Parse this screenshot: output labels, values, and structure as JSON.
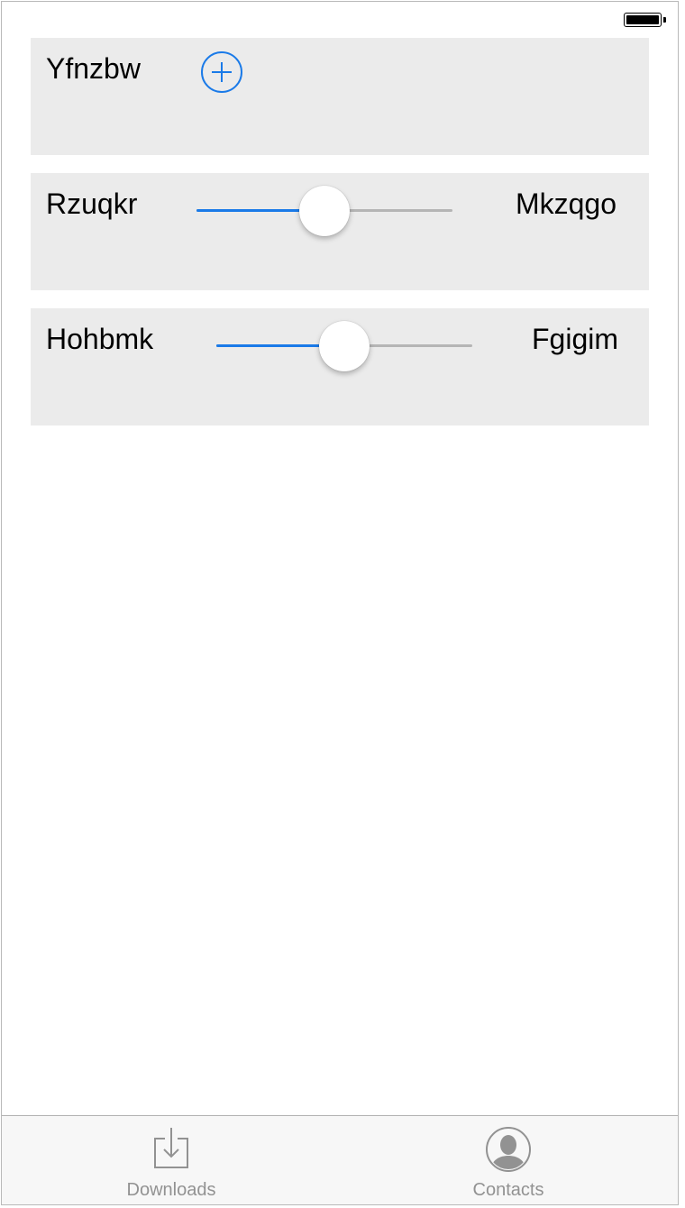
{
  "status_bar": {
    "battery_level": 1.0
  },
  "rows": [
    {
      "label": "Yfnzbw",
      "control": "add-button",
      "control_icon": "plus-circle-icon"
    },
    {
      "label": "Rzuqkr",
      "control": "slider",
      "value": 0.5,
      "trailing_label": "Mkzqgo"
    },
    {
      "label": "Hohbmk",
      "control": "slider",
      "value": 0.5,
      "trailing_label": "Fgigim"
    }
  ],
  "tabbar": {
    "tabs": [
      {
        "label": "Downloads",
        "icon": "download-icon"
      },
      {
        "label": "Contacts",
        "icon": "contact-icon"
      }
    ]
  },
  "colors": {
    "accent": "#1a7ae8",
    "card_background": "#ebebeb",
    "track_inactive": "#b5b5b5",
    "tab_label": "#929292"
  }
}
